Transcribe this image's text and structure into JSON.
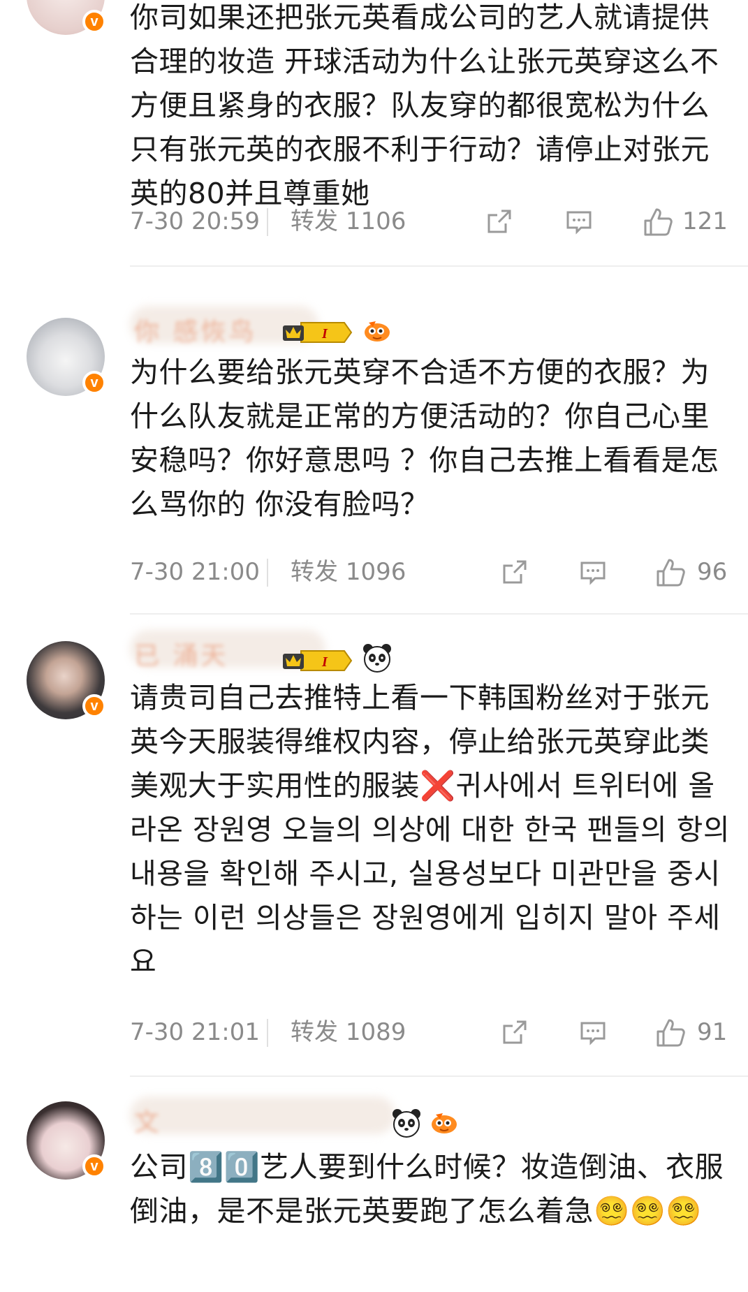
{
  "comments": [
    {
      "text": "你司如果还把张元英看成公司的艺人就请提供合理的妆造 开球活动为什么让张元英穿这么不方便且紧身的衣服？队友穿的都很宽松为什么只有张元英的衣服不利于行动？请停止对张元英的80并且尊重她",
      "time": "7-30 20:59",
      "repost_label": "转发",
      "repost_count": "1106",
      "likes": "121",
      "avatar_colors": [
        "#f2e4e2",
        "#d9bdb8"
      ]
    },
    {
      "name": "你 感恢鸟",
      "level_badge": "I",
      "text": "为什么要给张元英穿不合适不方便的衣服？为什么队友就是正常的方便活动的？你自己心里安稳吗？你好意思吗 ？你自己去推上看看是怎么骂你的 你没有脸吗？",
      "time": "7-30 21:00",
      "repost_label": "转发",
      "repost_count": "1096",
      "likes": "96",
      "avatar_colors": [
        "#e8e8ea",
        "#b9bcc2"
      ]
    },
    {
      "name": "已 涌天",
      "level_badge": "I",
      "text": "请贵司自己去推特上看一下韩国粉丝对于张元英今天服装得维权内容，停止给张元英穿此类美观大于实用性的服装❌귀사에서 트위터에 올라온 장원영 오늘의 의상에 대한 한국 팬들의 항의 내용을 확인해 주시고, 실용성보다 미관만을 중시하는 이런 의상들은 장원영에게 입히지 말아 주세요",
      "time": "7-30 21:01",
      "repost_label": "转发",
      "repost_count": "1089",
      "likes": "91",
      "avatar_colors": [
        "#3b3f48",
        "#c9b3a8"
      ]
    },
    {
      "name": "文",
      "text": "公司8️⃣0️⃣艺人要到什么时候？妆造倒油、衣服倒油，是不是张元英要跑了怎么着急😵‍💫😵‍💫😵‍💫",
      "avatar_colors": [
        "#f0dde0",
        "#2d2424"
      ]
    }
  ],
  "icons": {
    "share": "share-icon",
    "comment": "comment-icon",
    "like": "thumbs-up-icon",
    "verified": "verified-v-icon"
  },
  "colors": {
    "accent_orange": "#ff8200",
    "meta_gray": "#8a8a8a",
    "level_gold": "#f5c518"
  },
  "verified_glyph": "v"
}
